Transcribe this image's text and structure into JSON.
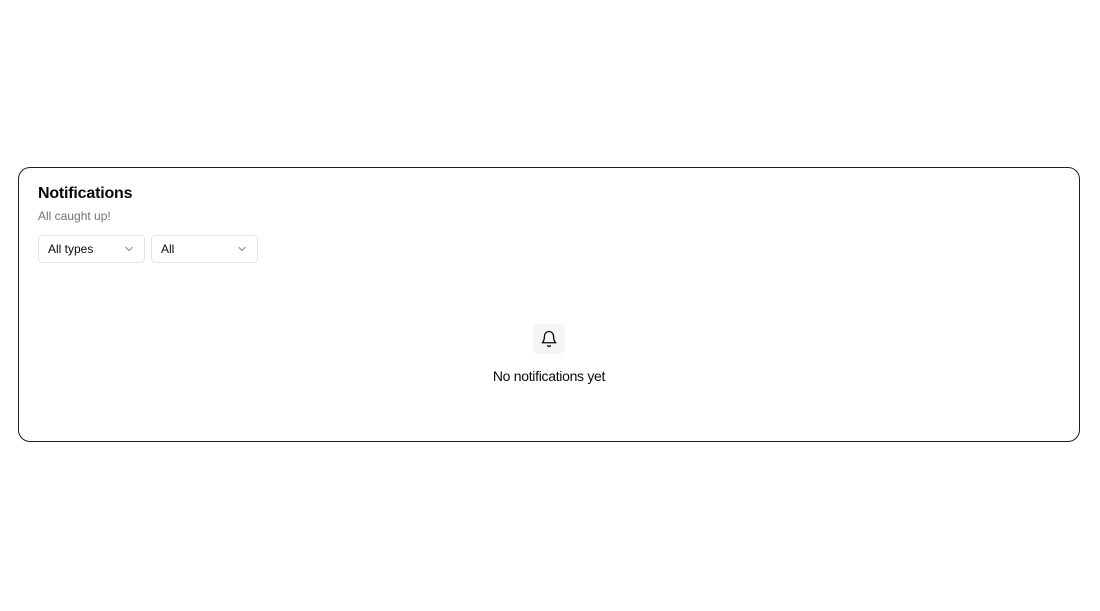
{
  "notifications": {
    "title": "Notifications",
    "subtitle": "All caught up!",
    "filters": {
      "type": {
        "selected": "All types",
        "icon": "chevron-down-icon"
      },
      "status": {
        "selected": "All",
        "icon": "chevron-down-icon"
      }
    },
    "empty_state": {
      "icon": "bell-icon",
      "message": "No notifications yet"
    }
  }
}
